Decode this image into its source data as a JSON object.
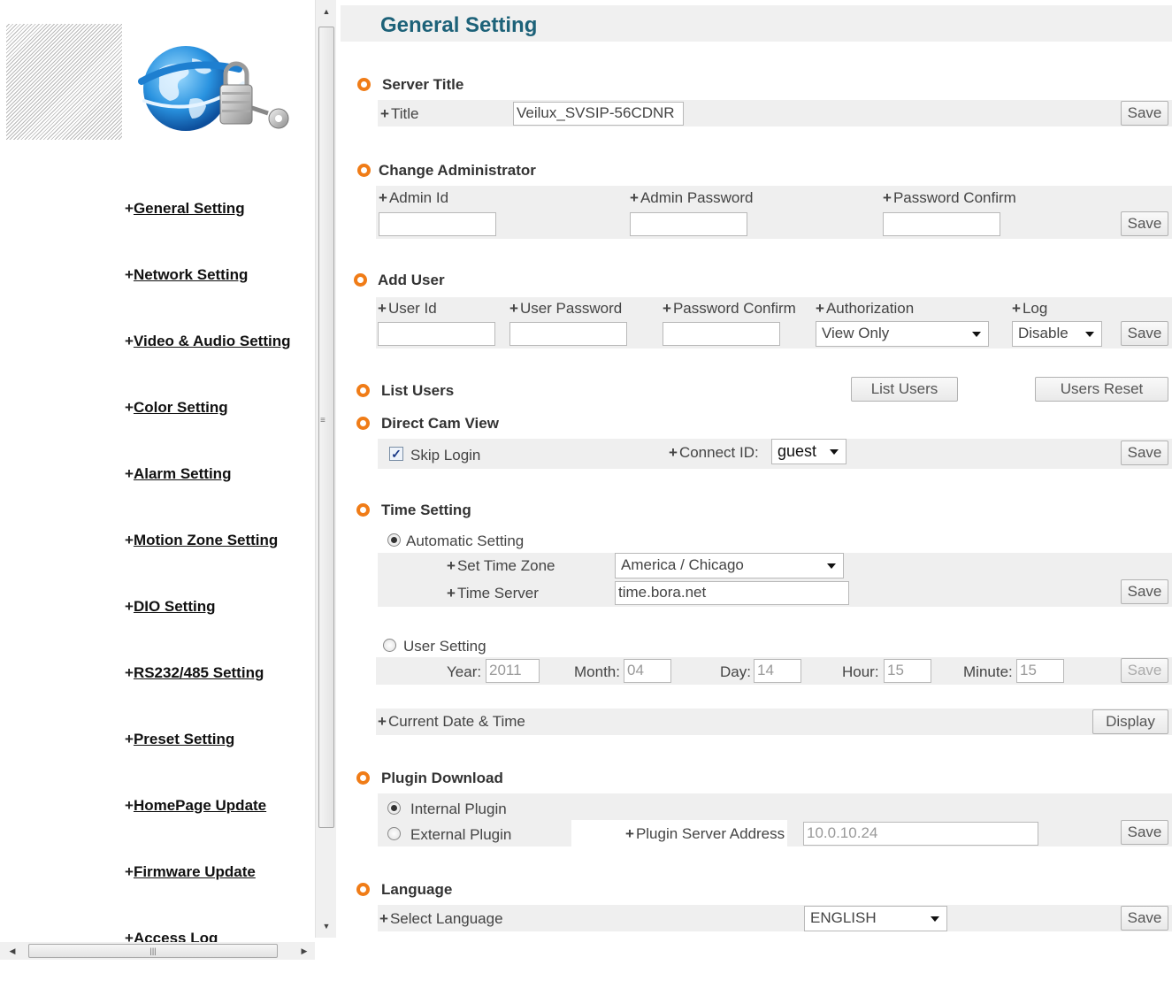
{
  "sidebar": {
    "items": [
      {
        "label": "General Setting"
      },
      {
        "label": "Network Setting"
      },
      {
        "label": "Video & Audio Setting"
      },
      {
        "label": "Color Setting"
      },
      {
        "label": "Alarm Setting"
      },
      {
        "label": "Motion Zone Setting"
      },
      {
        "label": "DIO Setting"
      },
      {
        "label": "RS232/485 Setting"
      },
      {
        "label": "Preset Setting"
      },
      {
        "label": "HomePage Update"
      },
      {
        "label": "Firmware Update"
      },
      {
        "label": "Access Log"
      }
    ]
  },
  "page": {
    "title": "General Setting"
  },
  "plus": "+",
  "save": "Save",
  "server_title": {
    "heading": "Server Title",
    "title_label": "Title",
    "title_value": "Veilux_SVSIP-56CDNR"
  },
  "admin": {
    "heading": "Change Administrator",
    "id_label": "Admin Id",
    "password_label": "Admin Password",
    "confirm_label": "Password Confirm"
  },
  "add_user": {
    "heading": "Add User",
    "id_label": "User Id",
    "password_label": "User Password",
    "confirm_label": "Password Confirm",
    "auth_label": "Authorization",
    "auth_value": "View Only",
    "log_label": "Log",
    "log_value": "Disable"
  },
  "list_users": {
    "heading": "List Users",
    "list_button": "List Users",
    "reset_button": "Users Reset"
  },
  "direct_cam": {
    "heading": "Direct Cam View",
    "skip_label": "Skip Login",
    "skip_checked": true,
    "connect_label": "Connect ID:",
    "connect_value": "guest"
  },
  "time": {
    "heading": "Time Setting",
    "auto_label": "Automatic Setting",
    "zone_label": "Set Time Zone",
    "zone_value": "America / Chicago",
    "server_label": "Time Server",
    "server_value": "time.bora.net",
    "user_label": "User Setting",
    "year_label": "Year:",
    "year_value": "2011",
    "month_label": "Month:",
    "month_value": "04",
    "day_label": "Day:",
    "day_value": "14",
    "hour_label": "Hour:",
    "hour_value": "15",
    "minute_label": "Minute:",
    "minute_value": "15",
    "current_label": "Current Date & Time",
    "display_button": "Display"
  },
  "plugin": {
    "heading": "Plugin Download",
    "internal_label": "Internal Plugin",
    "external_label": "External Plugin",
    "server_label": "Plugin Server Address",
    "server_value": "10.0.10.24"
  },
  "language": {
    "heading": "Language",
    "select_label": "Select Language",
    "select_value": "ENGLISH"
  },
  "scroll_glyphs": {
    "up": "▲",
    "down": "▼",
    "left": "◀",
    "right": "▶",
    "grip": "≡",
    "hgrip": "|||"
  },
  "colors": {
    "accent_orange": "#f07c17",
    "title_blue": "#1d6279",
    "section_gray": "#efefef"
  }
}
